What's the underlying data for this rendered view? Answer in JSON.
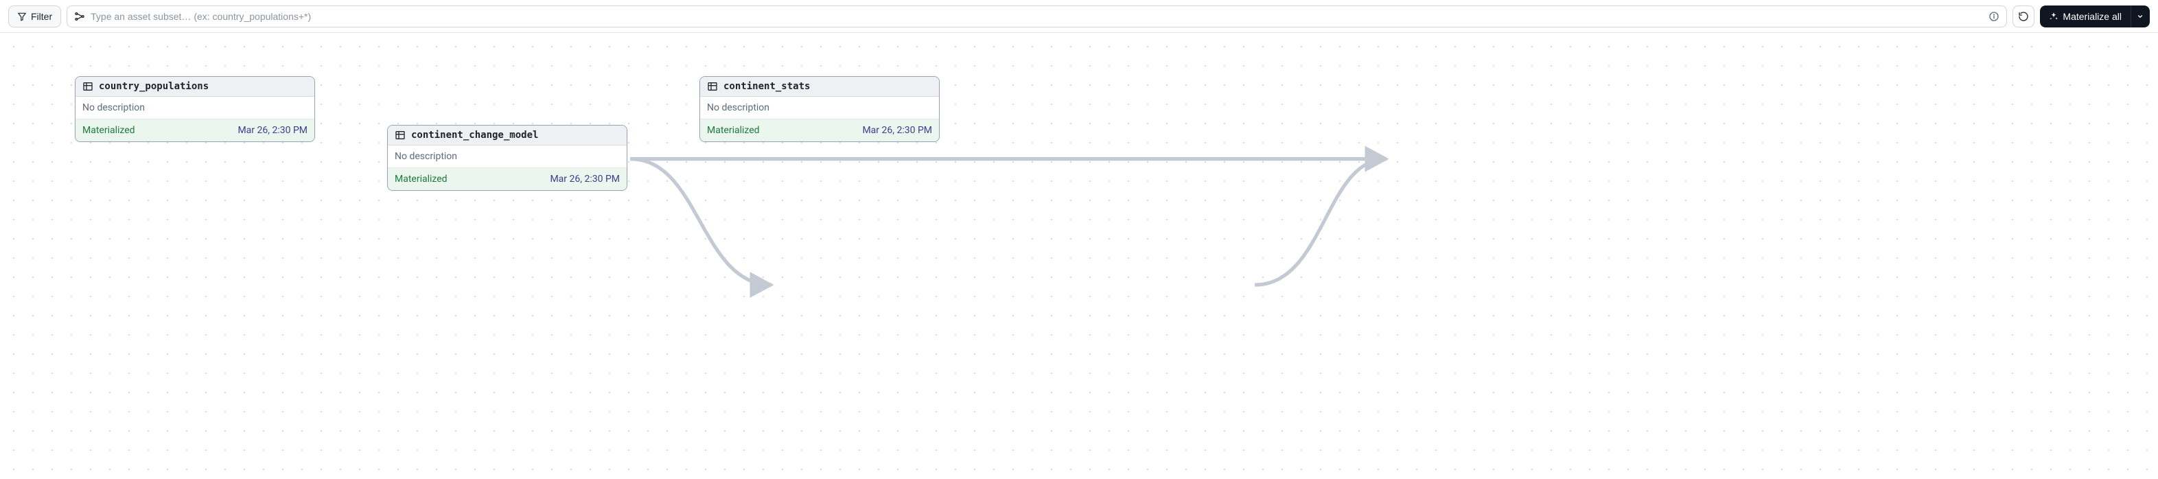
{
  "toolbar": {
    "filter_label": "Filter",
    "search_placeholder": "Type an asset subset… (ex: country_populations+*)",
    "materialize_label": "Materialize all"
  },
  "nodes": [
    {
      "id": "country_populations",
      "name": "country_populations",
      "description": "No description",
      "status": "Materialized",
      "timestamp": "Mar 26, 2:30 PM"
    },
    {
      "id": "continent_change_model",
      "name": "continent_change_model",
      "description": "No description",
      "status": "Materialized",
      "timestamp": "Mar 26, 2:30 PM"
    },
    {
      "id": "continent_stats",
      "name": "continent_stats",
      "description": "No description",
      "status": "Materialized",
      "timestamp": "Mar 26, 2:30 PM"
    }
  ]
}
